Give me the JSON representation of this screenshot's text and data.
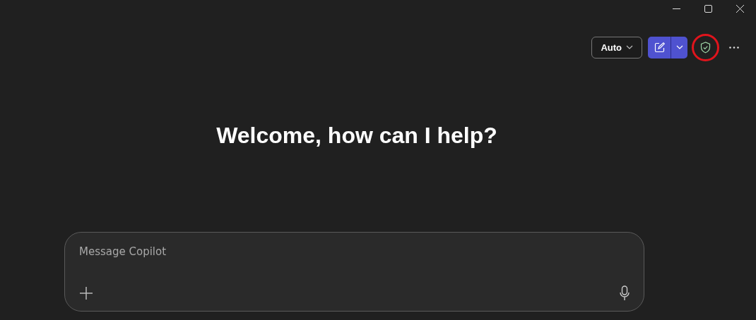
{
  "toolbar": {
    "mode_button": {
      "label": "Auto"
    },
    "shield_button": {
      "highlighted": true
    }
  },
  "heading": "Welcome, how can I help?",
  "composer": {
    "placeholder": "Message Copilot"
  }
}
